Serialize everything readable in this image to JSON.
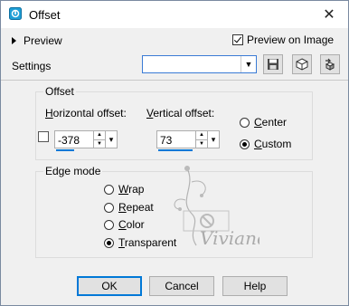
{
  "window": {
    "title": "Offset",
    "close_label": "✕"
  },
  "preview": {
    "toggle_label": "Preview",
    "on_image_label": "Preview on Image",
    "on_image_checked": true
  },
  "settings": {
    "label": "Settings",
    "value": ""
  },
  "offset": {
    "group_title": "Offset",
    "horizontal_prefix": "H",
    "horizontal_rest": "orizontal offset:",
    "horizontal_value": "-378",
    "vertical_prefix": "V",
    "vertical_rest": "ertical offset:",
    "vertical_value": "73",
    "center_prefix": "C",
    "center_rest": "enter",
    "custom_prefix": "C",
    "custom_rest": "ustom",
    "selected": "custom"
  },
  "edge_mode": {
    "group_title": "Edge mode",
    "options": [
      {
        "prefix": "W",
        "rest": "rap",
        "checked": false
      },
      {
        "prefix": "R",
        "rest": "epeat",
        "checked": false
      },
      {
        "prefix": "C",
        "rest": "olor",
        "checked": false
      },
      {
        "prefix": "T",
        "rest": "ransparent",
        "checked": true
      }
    ]
  },
  "buttons": {
    "ok": "OK",
    "cancel": "Cancel",
    "help": "Help"
  },
  "watermark": {
    "text": "Viviane"
  },
  "colors": {
    "accent": "#0078d7",
    "dialog_bg": "#f0f0f0"
  }
}
